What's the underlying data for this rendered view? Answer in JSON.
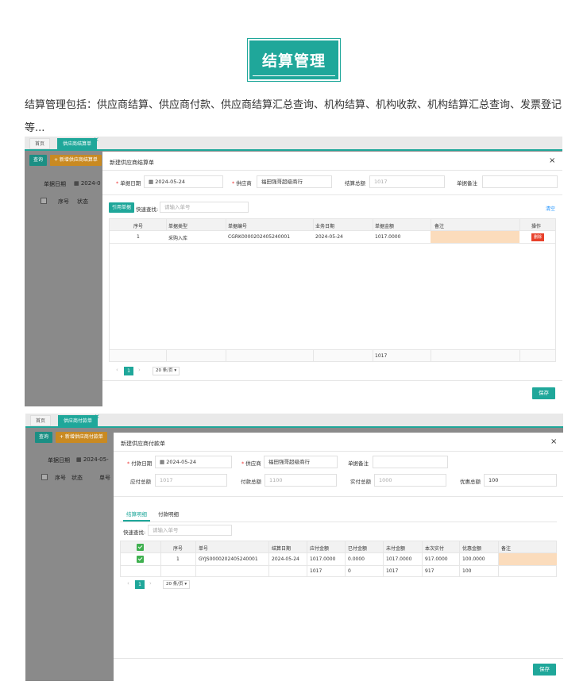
{
  "header": {
    "title": "结算管理",
    "intro": "结算管理包括：供应商结算、供应商付款、供应商结算汇总查询、机构结算、机构收款、机构结算汇总查询、发票登记等..."
  },
  "shot1": {
    "tabs": [
      "首页",
      "供应商结算单"
    ],
    "bg": {
      "query": "查询",
      "add": "+ 新增供应商结算单",
      "date_label": "单据日期",
      "date_value": "2024-0",
      "col_no": "序号",
      "col_status": "状态"
    },
    "modal": {
      "title": "新建供应商结算单",
      "close": "×",
      "doc_date_label": "单据日期",
      "doc_date_value": "2024-05-24",
      "supplier_label": "供应商",
      "supplier_value": "福田强哥超级商行",
      "total_label": "结算总额",
      "total_value": "1017",
      "remark_label": "单据备注",
      "ref_button": "引用单据",
      "quick_search_label": "快速查找:",
      "quick_search_placeholder": "请输入单号",
      "clear_link": "清空",
      "columns": [
        "序号",
        "单据类型",
        "单据编号",
        "业务日期",
        "单据金额",
        "备注",
        "操作"
      ],
      "rows": [
        {
          "no": "1",
          "type": "采购入库",
          "code": "CGRK0000202405240001",
          "date": "2024-05-24",
          "amount": "1017.0000",
          "remark": "",
          "action": "删除"
        }
      ],
      "sum_amount": "1017",
      "pager": {
        "page": "1",
        "size": "20 条/页 ▾",
        "prev": "‹",
        "next": "›"
      },
      "save": "保存"
    }
  },
  "shot2": {
    "tabs": [
      "首页",
      "供应商付款单"
    ],
    "bg": {
      "query": "查询",
      "add": "+ 新增供应商付款单",
      "date_label": "单据日期",
      "date_value": "2024-05-",
      "col_no": "序号",
      "col_status": "状态",
      "col_code": "单号"
    },
    "modal": {
      "title": "新建供应商付款单",
      "close": "×",
      "pay_date_label": "付款日期",
      "pay_date_value": "2024-05-24",
      "supplier_label": "供应商",
      "supplier_value": "福田强哥超级商行",
      "remark_label": "单据备注",
      "payable_label": "应付总额",
      "payable_value": "1017",
      "paid_total_label": "付款总额",
      "paid_total_value": "1100",
      "actual_label": "实付总额",
      "actual_value": "1000",
      "discount_label": "优惠总额",
      "discount_value": "100",
      "tab_settlement": "结算明细",
      "tab_payment": "付款明细",
      "quick_search_label": "快速查找:",
      "quick_search_placeholder": "请输入单号",
      "columns": [
        "序号",
        "单号",
        "结算日期",
        "应付金额",
        "已付金额",
        "未付金额",
        "本次实付",
        "优惠金额",
        "备注"
      ],
      "rows": [
        {
          "no": "1",
          "code": "GYJS0000202405240001",
          "date": "2024-05-24",
          "payable": "1017.0000",
          "paid": "0.0000",
          "unpaid": "1017.0000",
          "actual": "917.0000",
          "discount": "100.0000",
          "remark": ""
        }
      ],
      "sums": {
        "payable": "1017",
        "paid": "0",
        "unpaid": "1017",
        "actual": "917",
        "discount": "100"
      },
      "pager": {
        "page": "1",
        "size": "20 条/页 ▾",
        "prev": "‹",
        "next": "›"
      },
      "save": "保存"
    }
  },
  "colors": {
    "accent": "#1fa79a",
    "danger": "#e8402a",
    "remark_fill": "#fbdcbc",
    "overlay": "#8a8a8a"
  }
}
